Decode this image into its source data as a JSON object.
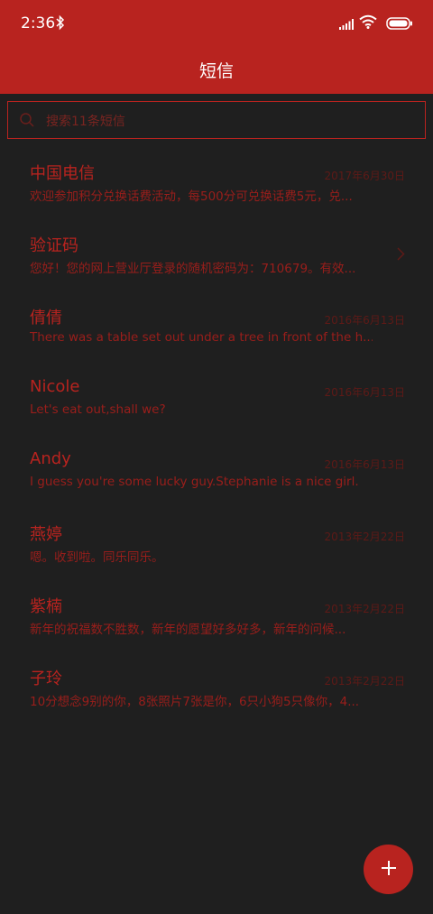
{
  "status_bar": {
    "time": "2:36",
    "icons": [
      "bluetooth-icon",
      "signal-icon",
      "wifi-icon",
      "battery-icon"
    ]
  },
  "header": {
    "title": "短信"
  },
  "search": {
    "placeholder": "搜索11条短信",
    "icon": "search-icon"
  },
  "messages": [
    {
      "name": "中国电信",
      "preview": "欢迎参加积分兑换话费活动，每500分可兑换话费5元，兑...",
      "date": "2017年6月30日"
    },
    {
      "name": "验证码",
      "preview": "您好！您的网上营业厅登录的随机密码为：710679。有效...",
      "date": "",
      "icon": "chevron-right-icon"
    },
    {
      "name": "倩倩",
      "preview": "There was a table set out under a tree in front of the h...",
      "date": "2016年6月13日"
    },
    {
      "name": "Nicole",
      "preview": "Let's eat out,shall we?",
      "date": "2016年6月13日"
    },
    {
      "name": "Andy",
      "preview": "I guess you're some lucky guy.Stephanie is a nice girl.",
      "date": "2016年6月13日"
    },
    {
      "name": "燕婷",
      "preview": "嗯。收到啦。同乐同乐。",
      "date": "2013年2月22日"
    },
    {
      "name": "紫楠",
      "preview": "新年的祝福数不胜数，新年的愿望好多好多，新年的问候...",
      "date": "2013年2月22日"
    },
    {
      "name": "子玲",
      "preview": "10分想念9别的你，8张照片7张是你，6只小狗5只像你，4...",
      "date": "2013年2月22日"
    }
  ],
  "fab": {
    "icon": "plus-icon"
  },
  "colors": {
    "accent": "#b8231f",
    "background": "#1f1f1f",
    "date_text": "#5e1a17"
  }
}
